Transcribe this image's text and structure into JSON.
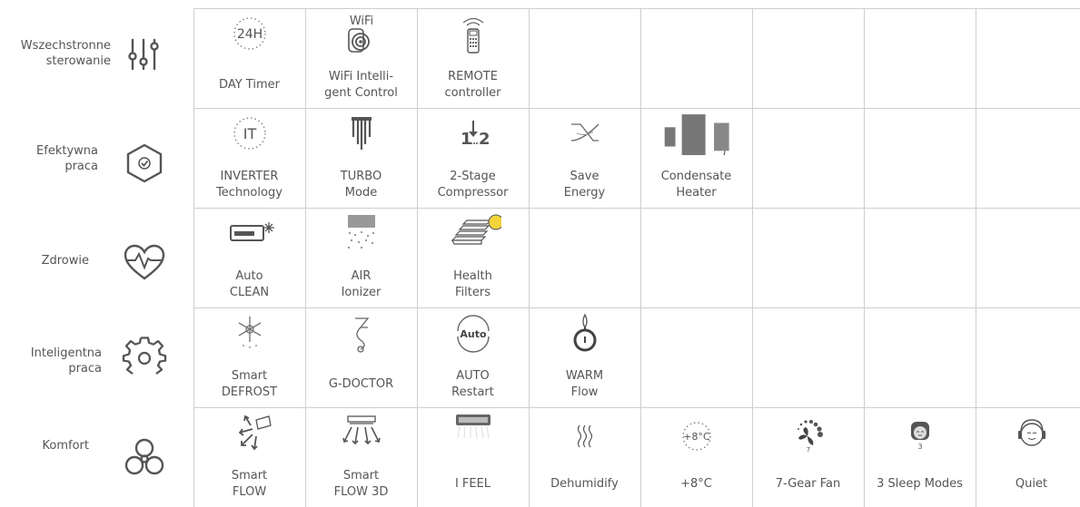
{
  "categories": [
    {
      "label_line1": "Wszechstronne",
      "label_line2": "sterowanie",
      "icon": "sliders-icon"
    },
    {
      "label_line1": "Efektywna",
      "label_line2": "praca",
      "icon": "check-shield-icon"
    },
    {
      "label_line1": "Zdrowie",
      "label_line2": "",
      "icon": "heartbeat-icon"
    },
    {
      "label_line1": "Inteligentna",
      "label_line2": "praca",
      "icon": "gear-icon"
    },
    {
      "label_line1": "Komfort",
      "label_line2": "",
      "icon": "fan-icon"
    }
  ],
  "features": {
    "row0": [
      {
        "l1": "DAY Timer",
        "l2": "",
        "icon_text": "24H"
      },
      {
        "l1": "WiFi Intelli-",
        "l2": "gent Control",
        "icon_text": "WiFi"
      },
      {
        "l1": "REMOTE",
        "l2": "controller"
      }
    ],
    "row1": [
      {
        "l1": "INVERTER",
        "l2": "Technology",
        "icon_text": "IT"
      },
      {
        "l1": "TURBO",
        "l2": "Mode"
      },
      {
        "l1": "2-Stage",
        "l2": "Compressor",
        "icon_text": "1",
        "icon_text2": "2"
      },
      {
        "l1": "Save",
        "l2": "Energy"
      },
      {
        "l1": "Condensate",
        "l2": "Heater"
      }
    ],
    "row2": [
      {
        "l1": "Auto",
        "l2": "CLEAN"
      },
      {
        "l1": "AIR",
        "l2": "Ionizer"
      },
      {
        "l1": "Health",
        "l2": "Filters"
      }
    ],
    "row3": [
      {
        "l1": "Smart",
        "l2": "DEFROST"
      },
      {
        "l1": "G-DOCTOR",
        "l2": ""
      },
      {
        "l1": "AUTO",
        "l2": "Restart",
        "icon_text": "Auto"
      },
      {
        "l1": "WARM",
        "l2": "Flow"
      }
    ],
    "row4": [
      {
        "l1": "Smart",
        "l2": "FLOW"
      },
      {
        "l1": "Smart",
        "l2": "FLOW 3D"
      },
      {
        "l1": "I FEEL",
        "l2": ""
      },
      {
        "l1": "Dehumidify",
        "l2": ""
      },
      {
        "l1": "+8°C",
        "l2": "",
        "icon_text": "+8°C"
      },
      {
        "l1": "7-Gear Fan",
        "l2": "",
        "icon_text": "7"
      },
      {
        "l1": "3 Sleep Modes",
        "l2": "",
        "icon_text": "3"
      },
      {
        "l1": "Quiet",
        "l2": ""
      }
    ]
  },
  "colors": {
    "grid": "#cfcfcf",
    "text": "#555555",
    "icon": "#666666",
    "yellow_dot": "#f2d43a",
    "blue_dot": "#bfe3ef"
  }
}
